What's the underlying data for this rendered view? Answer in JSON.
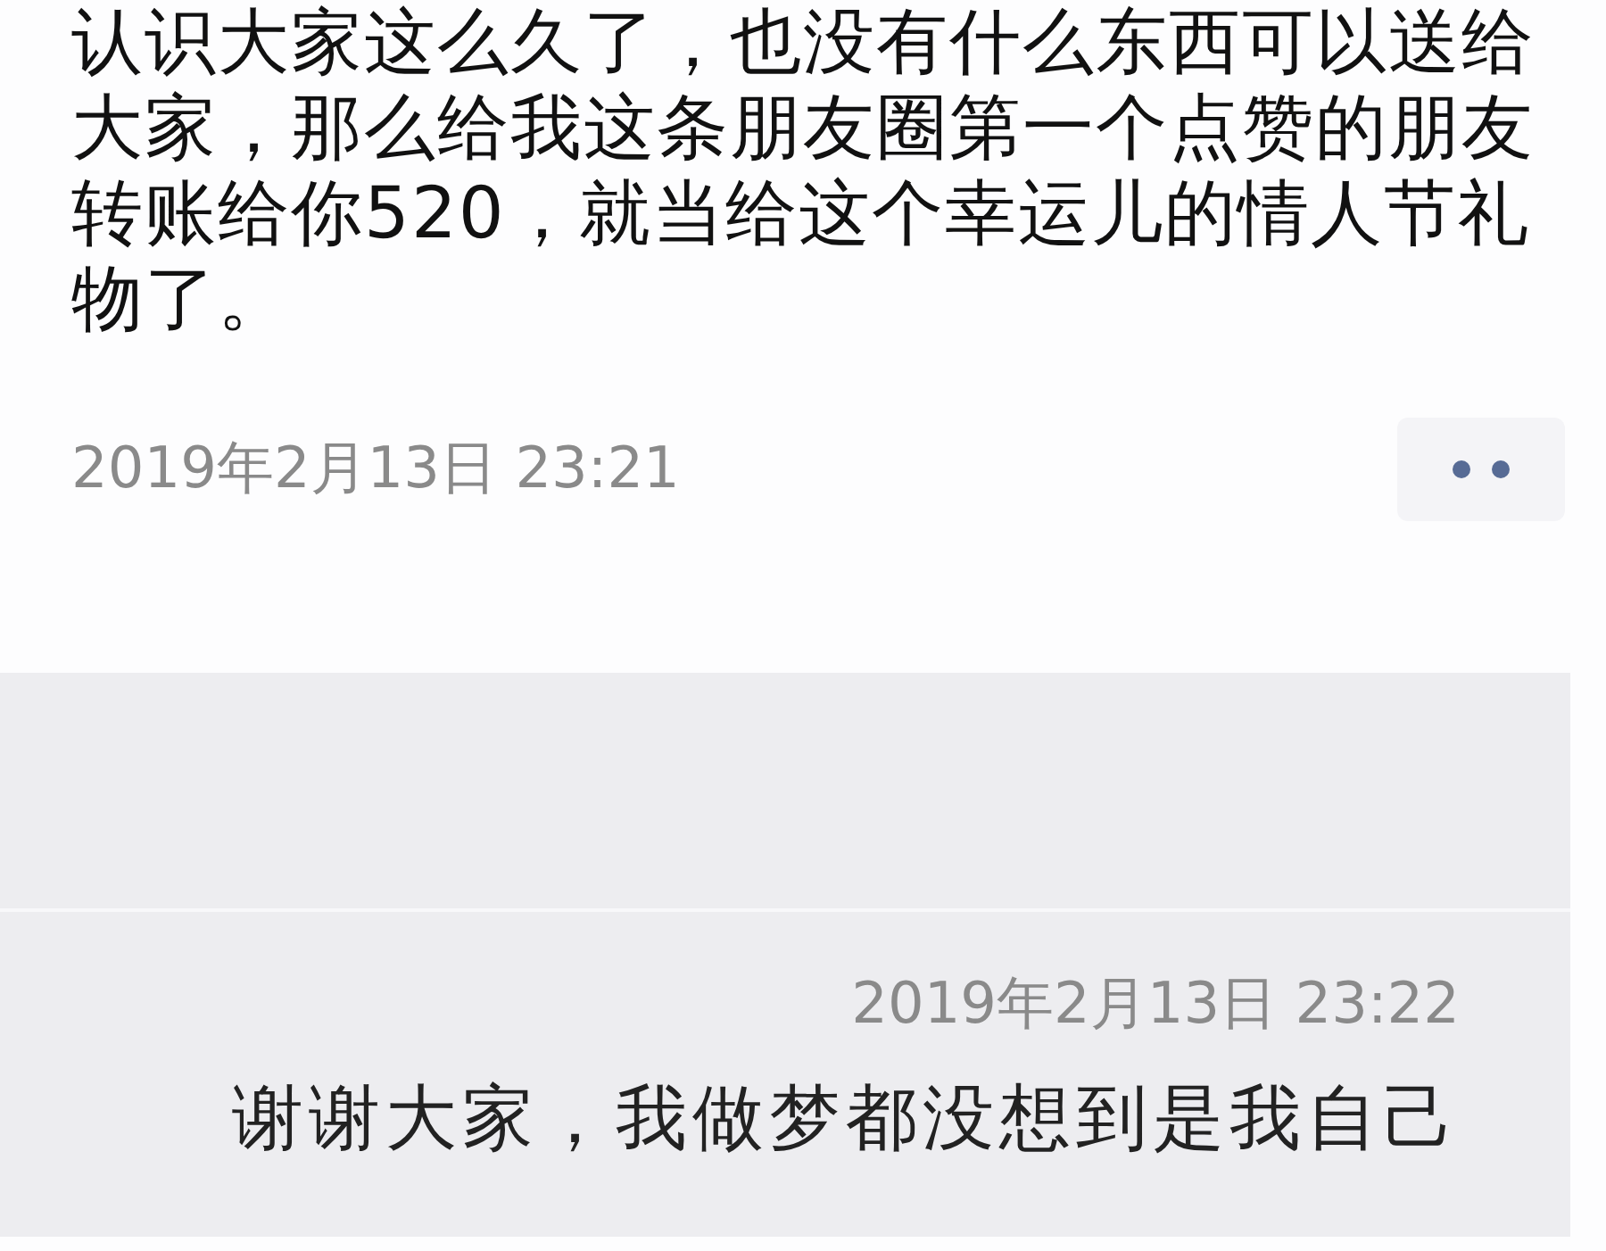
{
  "post": {
    "lines": [
      "认识大家这么久了，也没有什么东西可以送给",
      "大家，那么给我这条朋友圈第一个点赞的朋友",
      "转账给你520，就当给这个幸运儿的情人节礼",
      "物了。"
    ],
    "time": "2019年2月13日 23:21"
  },
  "comments": [
    {
      "time": "2019年2月13日 23:22",
      "text": "谢谢大家，我做梦都没想到是我自己"
    }
  ]
}
